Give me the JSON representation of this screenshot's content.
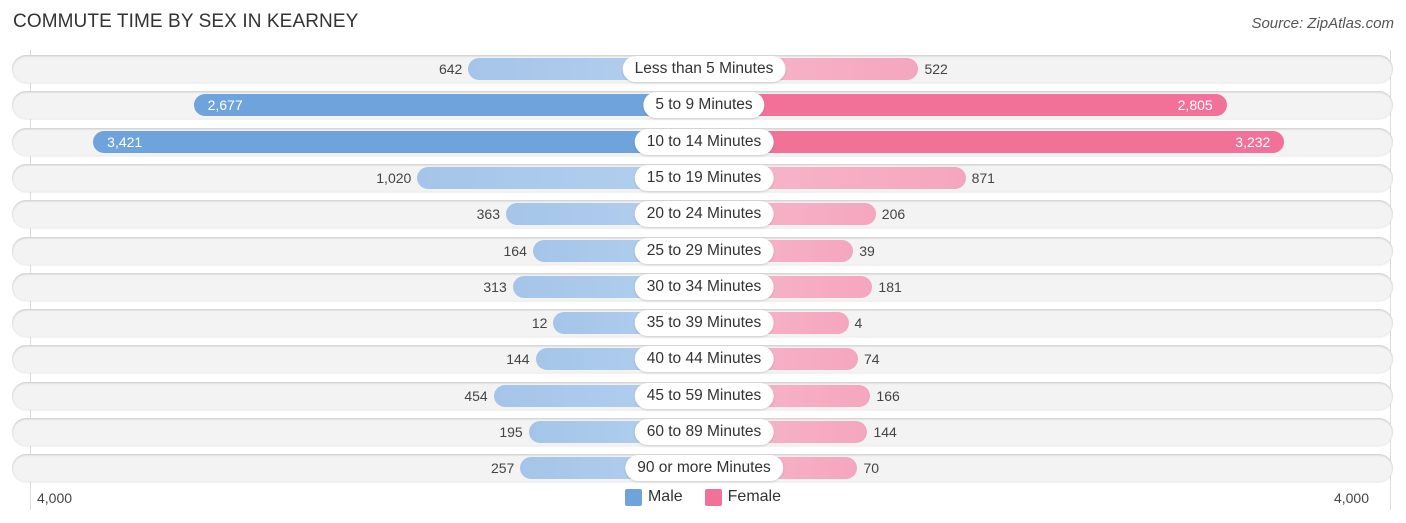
{
  "title": "COMMUTE TIME BY SEX IN KEARNEY",
  "source": "Source: ZipAtlas.com",
  "colors": {
    "male": "#6fa3dc",
    "male_light": "#a4c5e9",
    "female": "#f27199",
    "female_light": "#f5a6bf"
  },
  "chart_data": {
    "type": "bar",
    "orientation": "horizontal-diverging",
    "title": "COMMUTE TIME BY SEX IN KEARNEY",
    "categories": [
      "Less than 5 Minutes",
      "5 to 9 Minutes",
      "10 to 14 Minutes",
      "15 to 19 Minutes",
      "20 to 24 Minutes",
      "25 to 29 Minutes",
      "30 to 34 Minutes",
      "35 to 39 Minutes",
      "40 to 44 Minutes",
      "45 to 59 Minutes",
      "60 to 89 Minutes",
      "90 or more Minutes"
    ],
    "series": [
      {
        "name": "Male",
        "values": [
          642,
          2677,
          3421,
          1020,
          363,
          164,
          313,
          12,
          144,
          454,
          195,
          257
        ],
        "labels": [
          "642",
          "2,677",
          "3,421",
          "1,020",
          "363",
          "164",
          "313",
          "12",
          "144",
          "454",
          "195",
          "257"
        ]
      },
      {
        "name": "Female",
        "values": [
          522,
          2805,
          3232,
          871,
          206,
          39,
          181,
          4,
          74,
          166,
          144,
          70
        ],
        "labels": [
          "522",
          "2,805",
          "3,232",
          "871",
          "206",
          "39",
          "181",
          "4",
          "74",
          "166",
          "144",
          "70"
        ]
      }
    ],
    "axis": {
      "min_label": "4,000",
      "max_label": "4,000",
      "range": [
        -4000,
        4000
      ]
    },
    "legend": {
      "position": "bottom-center",
      "entries": [
        "Male",
        "Female"
      ]
    },
    "xlabel": "",
    "ylabel": ""
  }
}
